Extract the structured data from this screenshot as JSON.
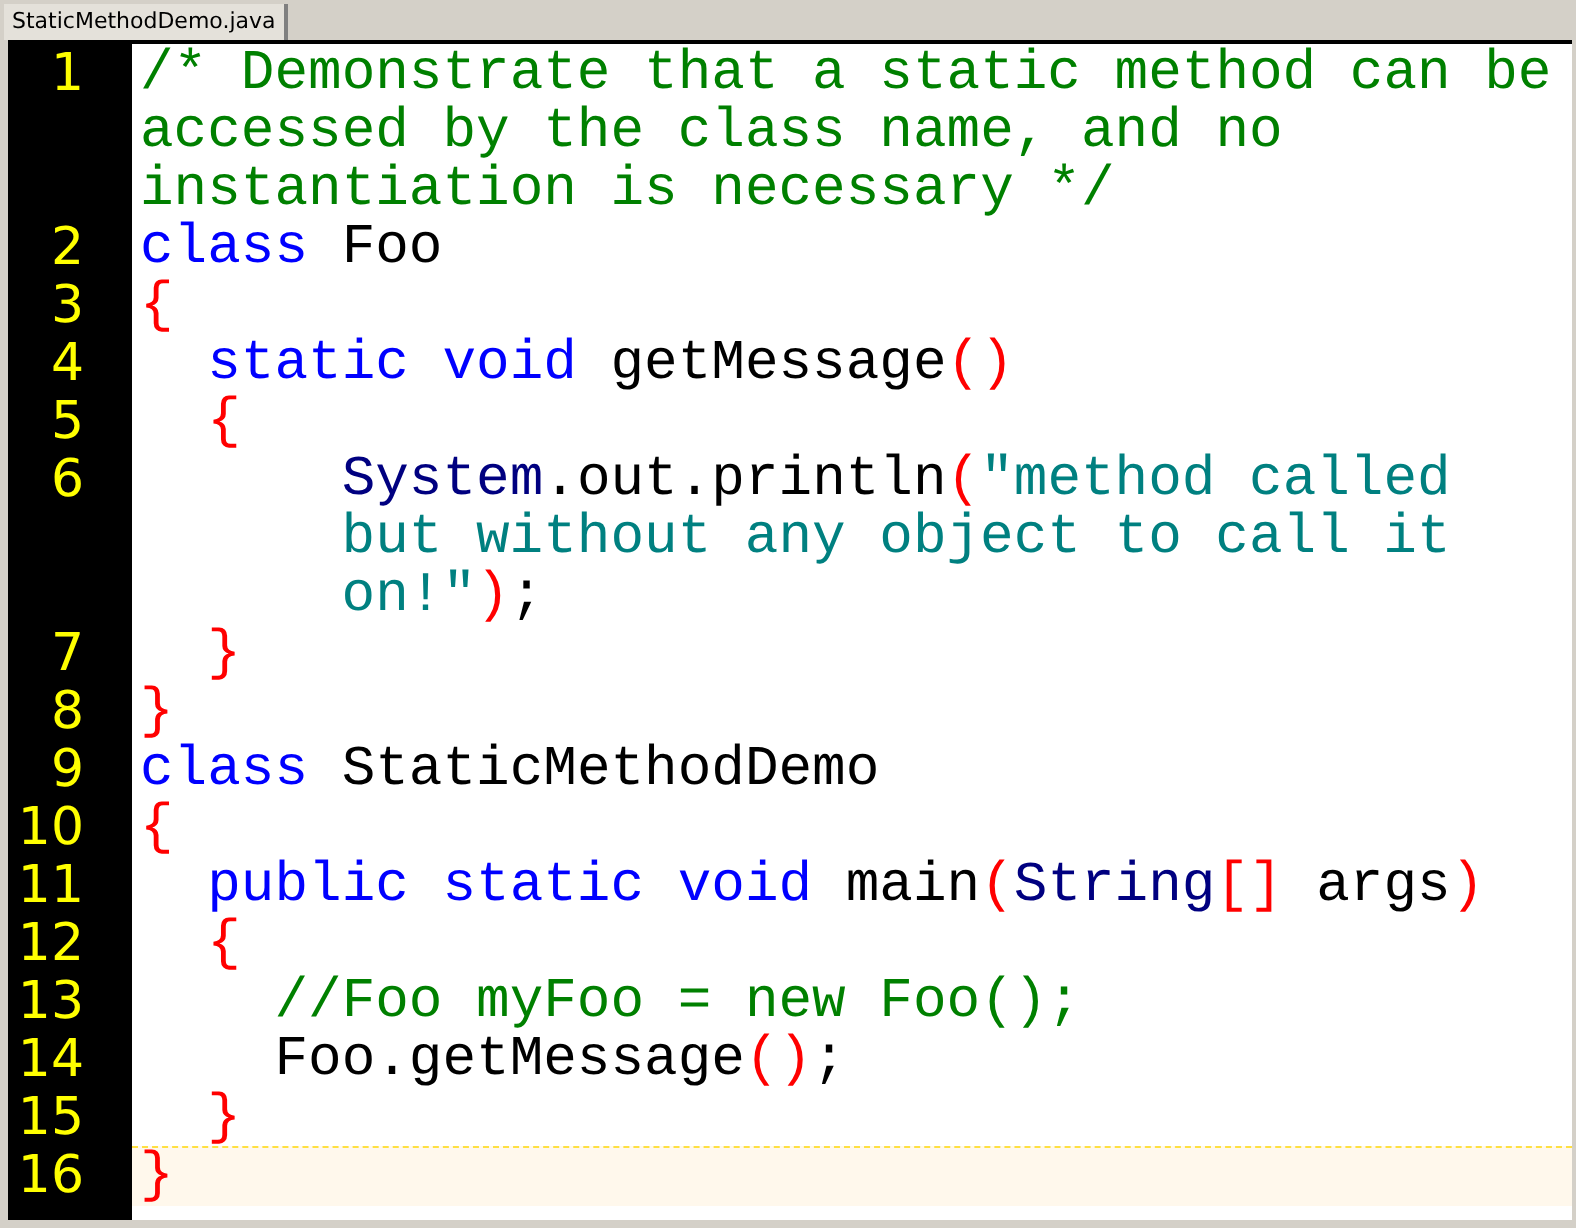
{
  "tabs": [
    {
      "label": "StaticMethodDemo.java",
      "selected": true
    }
  ],
  "lines": [
    {
      "number": "1",
      "current": false,
      "rows": [
        {
          "tokens": [
            {
              "kind": "comment",
              "text": "/* Demonstrate that a static method can be"
            }
          ]
        },
        {
          "tokens": [
            {
              "kind": "comment",
              "text": "accessed by the class name, and no"
            }
          ]
        },
        {
          "tokens": [
            {
              "kind": "comment",
              "text": "instantiation is necessary */"
            }
          ]
        }
      ]
    },
    {
      "number": "2",
      "current": false,
      "rows": [
        {
          "tokens": [
            {
              "kind": "keyword",
              "text": "class"
            },
            {
              "kind": "plain",
              "text": " Foo"
            }
          ]
        }
      ]
    },
    {
      "number": "3",
      "current": false,
      "rows": [
        {
          "tokens": [
            {
              "kind": "bracket",
              "text": "{"
            }
          ]
        }
      ]
    },
    {
      "number": "4",
      "current": false,
      "rows": [
        {
          "tokens": [
            {
              "kind": "keyword",
              "text": "  static void"
            },
            {
              "kind": "plain",
              "text": " getMessage"
            },
            {
              "kind": "bracket",
              "text": "()"
            }
          ]
        }
      ]
    },
    {
      "number": "5",
      "current": false,
      "rows": [
        {
          "tokens": [
            {
              "kind": "bracket",
              "text": "  {"
            }
          ]
        }
      ]
    },
    {
      "number": "6",
      "current": false,
      "rows": [
        {
          "tokens": [
            {
              "kind": "type",
              "text": "      System"
            },
            {
              "kind": "plain",
              "text": ".out.println"
            },
            {
              "kind": "bracket",
              "text": "("
            },
            {
              "kind": "string",
              "text": "\"method called"
            }
          ]
        },
        {
          "tokens": [
            {
              "kind": "string",
              "text": "but without any object to call it"
            }
          ]
        },
        {
          "tokens": [
            {
              "kind": "string",
              "text": "on!\""
            },
            {
              "kind": "bracket",
              "text": ")"
            },
            {
              "kind": "plain",
              "text": ";"
            }
          ]
        }
      ]
    },
    {
      "number": "7",
      "current": false,
      "rows": [
        {
          "tokens": [
            {
              "kind": "bracket",
              "text": "  }"
            }
          ]
        }
      ]
    },
    {
      "number": "8",
      "current": false,
      "rows": [
        {
          "tokens": [
            {
              "kind": "bracket",
              "text": "}"
            }
          ]
        }
      ]
    },
    {
      "number": "9",
      "current": false,
      "rows": [
        {
          "tokens": [
            {
              "kind": "keyword",
              "text": "class"
            },
            {
              "kind": "plain",
              "text": " StaticMethodDemo"
            }
          ]
        }
      ]
    },
    {
      "number": "10",
      "current": false,
      "rows": [
        {
          "tokens": [
            {
              "kind": "bracket",
              "text": "{"
            }
          ]
        }
      ]
    },
    {
      "number": "11",
      "current": false,
      "rows": [
        {
          "tokens": [
            {
              "kind": "keyword",
              "text": "  public static void"
            },
            {
              "kind": "plain",
              "text": " main"
            },
            {
              "kind": "bracket",
              "text": "("
            },
            {
              "kind": "type",
              "text": "String"
            },
            {
              "kind": "bracket",
              "text": "[]"
            },
            {
              "kind": "plain",
              "text": " args"
            },
            {
              "kind": "bracket",
              "text": ")"
            }
          ]
        }
      ]
    },
    {
      "number": "12",
      "current": false,
      "rows": [
        {
          "tokens": [
            {
              "kind": "bracket",
              "text": "  {"
            }
          ]
        }
      ]
    },
    {
      "number": "13",
      "current": false,
      "rows": [
        {
          "tokens": [
            {
              "kind": "comment",
              "text": "    //Foo myFoo = new Foo();"
            }
          ]
        }
      ]
    },
    {
      "number": "14",
      "current": false,
      "rows": [
        {
          "tokens": [
            {
              "kind": "plain",
              "text": "    Foo.getMessage"
            },
            {
              "kind": "bracket",
              "text": "()"
            },
            {
              "kind": "plain",
              "text": ";"
            }
          ]
        }
      ]
    },
    {
      "number": "15",
      "current": false,
      "rows": [
        {
          "tokens": [
            {
              "kind": "bracket",
              "text": "  }"
            }
          ]
        }
      ]
    },
    {
      "number": "16",
      "current": true,
      "rows": [
        {
          "tokens": [
            {
              "kind": "bracket",
              "text": "}"
            }
          ]
        }
      ]
    }
  ]
}
